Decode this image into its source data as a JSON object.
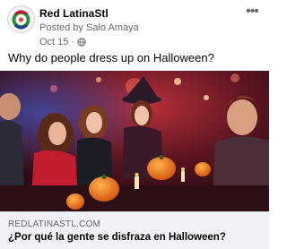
{
  "post": {
    "page_name": "Red LatinaStl",
    "posted_by": "Posted by Salo Amaya",
    "date": "Oct 15",
    "separator": "·",
    "privacy_icon": "globe-icon",
    "more_icon": "more-horizontal-icon",
    "more_label": "•••",
    "text": "Why do people dress up on Halloween?"
  },
  "link": {
    "image_description": "Group of young people at a Halloween party with jack-o'-lanterns",
    "domain": "REDLATINASTL.COM",
    "title": "¿Por qué la gente se disfraza en Halloween?"
  },
  "colors": {
    "secondary_text": "#65676b",
    "footer_bg": "#f0f2f5"
  }
}
